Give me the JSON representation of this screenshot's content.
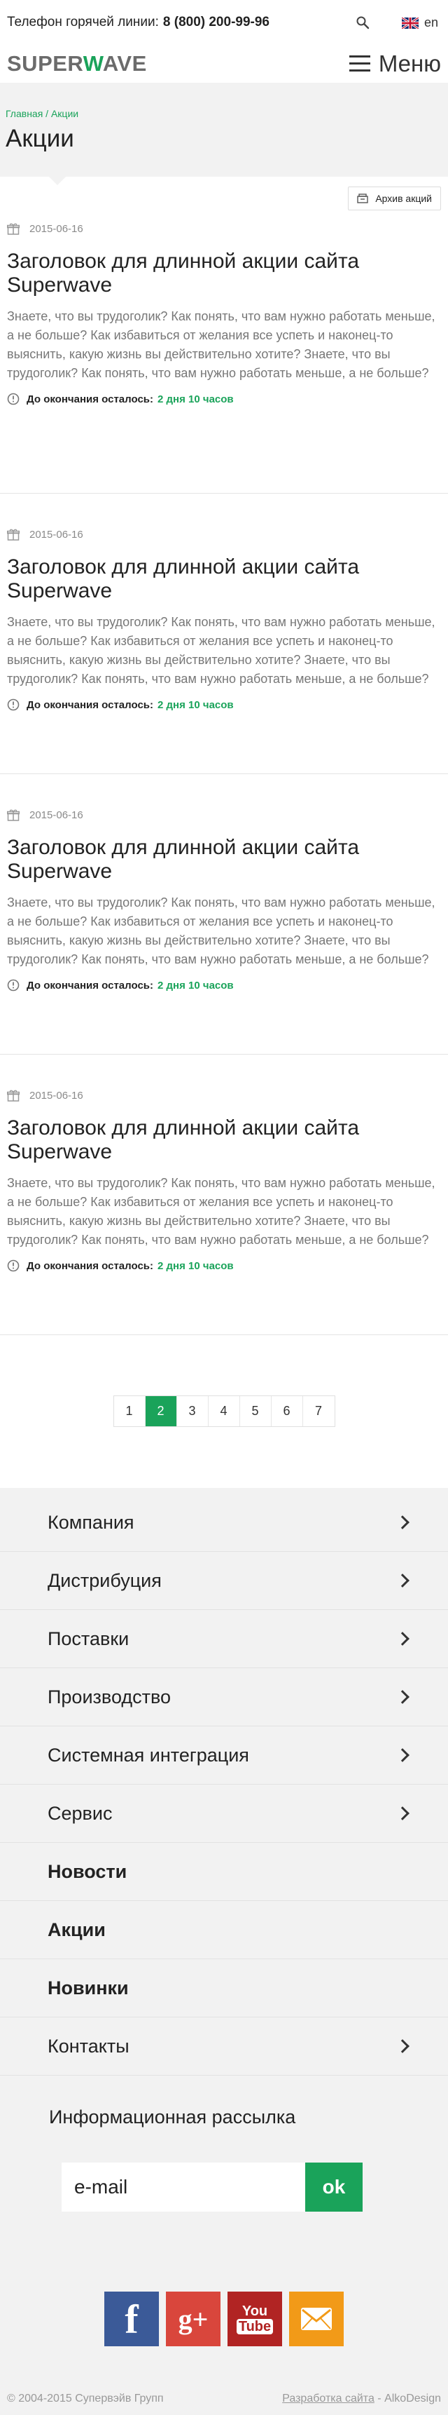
{
  "topbar": {
    "hotline_label": "Телефон горячей линии:",
    "hotline_phone": "8 (800) 200-99-96",
    "lang": "en"
  },
  "brand": {
    "logo_part1": "SUPER",
    "logo_part2": "W",
    "logo_part3": "AVE",
    "menu_label": "Меню"
  },
  "breadcrumb": {
    "home": "Главная",
    "separator": " / ",
    "current": "Акции"
  },
  "page_title": "Акции",
  "archive_label": "Архив акций",
  "promos": [
    {
      "date": "2015-06-16",
      "title": "Заголовок для длинной акции сайта Superwave",
      "text": "Знаете, что вы трудоголик? Как понять, что вам нужно работать меньше, а не больше? Как избавиться от желания все успеть и наконец-то выяснить, какую жизнь вы действительно хотите? Знаете, что вы трудоголик? Как понять, что вам нужно работать меньше, а не больше?",
      "remain_label": "До окончания осталось:",
      "remain_value": "2 дня 10 часов"
    },
    {
      "date": "2015-06-16",
      "title": "Заголовок для длинной акции сайта Superwave",
      "text": "Знаете, что вы трудоголик? Как понять, что вам нужно работать меньше, а не больше? Как избавиться от желания все успеть и наконец-то выяснить, какую жизнь вы действительно хотите? Знаете, что вы трудоголик? Как понять, что вам нужно работать меньше, а не больше?",
      "remain_label": "До окончания осталось:",
      "remain_value": "2 дня 10 часов"
    },
    {
      "date": "2015-06-16",
      "title": "Заголовок для длинной акции сайта Superwave",
      "text": "Знаете, что вы трудоголик? Как понять, что вам нужно работать меньше, а не больше? Как избавиться от желания все успеть и наконец-то выяснить, какую жизнь вы действительно хотите? Знаете, что вы трудоголик? Как понять, что вам нужно работать меньше, а не больше?",
      "remain_label": "До окончания осталось:",
      "remain_value": "2 дня 10 часов"
    },
    {
      "date": "2015-06-16",
      "title": "Заголовок для длинной акции сайта Superwave",
      "text": "Знаете, что вы трудоголик? Как понять, что вам нужно работать меньше, а не больше? Как избавиться от желания все успеть и наконец-то выяснить, какую жизнь вы действительно хотите? Знаете, что вы трудоголик? Как понять, что вам нужно работать меньше, а не больше?",
      "remain_label": "До окончания осталось:",
      "remain_value": "2 дня 10 часов"
    }
  ],
  "pagination": {
    "pages": [
      "1",
      "2",
      "3",
      "4",
      "5",
      "6",
      "7"
    ],
    "current": "2"
  },
  "footer_nav": [
    {
      "label": "Компания",
      "has_arrow": true,
      "bold": false
    },
    {
      "label": "Дистрибуция",
      "has_arrow": true,
      "bold": false
    },
    {
      "label": "Поставки",
      "has_arrow": true,
      "bold": false
    },
    {
      "label": "Производство",
      "has_arrow": true,
      "bold": false
    },
    {
      "label": "Системная интеграция",
      "has_arrow": true,
      "bold": false
    },
    {
      "label": "Сервис",
      "has_arrow": true,
      "bold": false
    },
    {
      "label": "Новости",
      "has_arrow": false,
      "bold": true
    },
    {
      "label": "Акции",
      "has_arrow": false,
      "bold": true
    },
    {
      "label": "Новинки",
      "has_arrow": false,
      "bold": true
    },
    {
      "label": "Контакты",
      "has_arrow": true,
      "bold": false
    }
  ],
  "newsletter": {
    "title": "Информационная рассылка",
    "placeholder": "e-mail",
    "submit": "ok"
  },
  "socials": [
    {
      "name": "facebook-icon",
      "glyph": "f"
    },
    {
      "name": "google-plus-icon",
      "glyph": "g+"
    },
    {
      "name": "youtube-icon",
      "glyph_top": "You",
      "glyph_bottom": "Tube"
    },
    {
      "name": "mail-icon"
    }
  ],
  "copyright": "© 2004-2015 Супервэйв Групп",
  "developer": {
    "link_text": "Разработка сайта",
    "separator": " - ",
    "name": "AlkoDesign"
  },
  "colors": {
    "accent": "#1aa35a",
    "facebook": "#3b5a98",
    "google_plus": "#d9463c",
    "youtube": "#b12423",
    "mail": "#f29a18",
    "footer_bg": "#f2f2f2"
  }
}
